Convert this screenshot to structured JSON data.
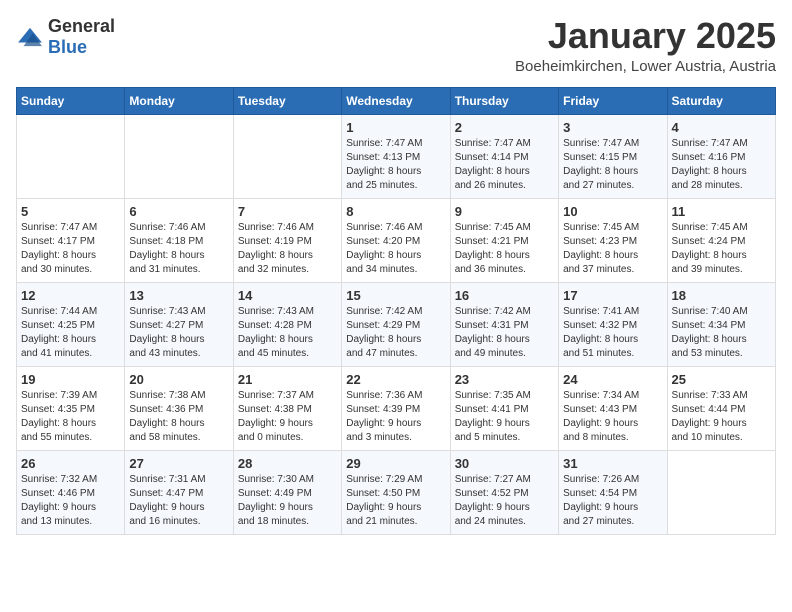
{
  "header": {
    "logo_general": "General",
    "logo_blue": "Blue",
    "month_title": "January 2025",
    "location": "Boeheimkirchen, Lower Austria, Austria"
  },
  "days_of_week": [
    "Sunday",
    "Monday",
    "Tuesday",
    "Wednesday",
    "Thursday",
    "Friday",
    "Saturday"
  ],
  "weeks": [
    {
      "cells": [
        {
          "day": null,
          "content": null
        },
        {
          "day": null,
          "content": null
        },
        {
          "day": null,
          "content": null
        },
        {
          "day": "1",
          "content": "Sunrise: 7:47 AM\nSunset: 4:13 PM\nDaylight: 8 hours\nand 25 minutes."
        },
        {
          "day": "2",
          "content": "Sunrise: 7:47 AM\nSunset: 4:14 PM\nDaylight: 8 hours\nand 26 minutes."
        },
        {
          "day": "3",
          "content": "Sunrise: 7:47 AM\nSunset: 4:15 PM\nDaylight: 8 hours\nand 27 minutes."
        },
        {
          "day": "4",
          "content": "Sunrise: 7:47 AM\nSunset: 4:16 PM\nDaylight: 8 hours\nand 28 minutes."
        }
      ]
    },
    {
      "cells": [
        {
          "day": "5",
          "content": "Sunrise: 7:47 AM\nSunset: 4:17 PM\nDaylight: 8 hours\nand 30 minutes."
        },
        {
          "day": "6",
          "content": "Sunrise: 7:46 AM\nSunset: 4:18 PM\nDaylight: 8 hours\nand 31 minutes."
        },
        {
          "day": "7",
          "content": "Sunrise: 7:46 AM\nSunset: 4:19 PM\nDaylight: 8 hours\nand 32 minutes."
        },
        {
          "day": "8",
          "content": "Sunrise: 7:46 AM\nSunset: 4:20 PM\nDaylight: 8 hours\nand 34 minutes."
        },
        {
          "day": "9",
          "content": "Sunrise: 7:45 AM\nSunset: 4:21 PM\nDaylight: 8 hours\nand 36 minutes."
        },
        {
          "day": "10",
          "content": "Sunrise: 7:45 AM\nSunset: 4:23 PM\nDaylight: 8 hours\nand 37 minutes."
        },
        {
          "day": "11",
          "content": "Sunrise: 7:45 AM\nSunset: 4:24 PM\nDaylight: 8 hours\nand 39 minutes."
        }
      ]
    },
    {
      "cells": [
        {
          "day": "12",
          "content": "Sunrise: 7:44 AM\nSunset: 4:25 PM\nDaylight: 8 hours\nand 41 minutes."
        },
        {
          "day": "13",
          "content": "Sunrise: 7:43 AM\nSunset: 4:27 PM\nDaylight: 8 hours\nand 43 minutes."
        },
        {
          "day": "14",
          "content": "Sunrise: 7:43 AM\nSunset: 4:28 PM\nDaylight: 8 hours\nand 45 minutes."
        },
        {
          "day": "15",
          "content": "Sunrise: 7:42 AM\nSunset: 4:29 PM\nDaylight: 8 hours\nand 47 minutes."
        },
        {
          "day": "16",
          "content": "Sunrise: 7:42 AM\nSunset: 4:31 PM\nDaylight: 8 hours\nand 49 minutes."
        },
        {
          "day": "17",
          "content": "Sunrise: 7:41 AM\nSunset: 4:32 PM\nDaylight: 8 hours\nand 51 minutes."
        },
        {
          "day": "18",
          "content": "Sunrise: 7:40 AM\nSunset: 4:34 PM\nDaylight: 8 hours\nand 53 minutes."
        }
      ]
    },
    {
      "cells": [
        {
          "day": "19",
          "content": "Sunrise: 7:39 AM\nSunset: 4:35 PM\nDaylight: 8 hours\nand 55 minutes."
        },
        {
          "day": "20",
          "content": "Sunrise: 7:38 AM\nSunset: 4:36 PM\nDaylight: 8 hours\nand 58 minutes."
        },
        {
          "day": "21",
          "content": "Sunrise: 7:37 AM\nSunset: 4:38 PM\nDaylight: 9 hours\nand 0 minutes."
        },
        {
          "day": "22",
          "content": "Sunrise: 7:36 AM\nSunset: 4:39 PM\nDaylight: 9 hours\nand 3 minutes."
        },
        {
          "day": "23",
          "content": "Sunrise: 7:35 AM\nSunset: 4:41 PM\nDaylight: 9 hours\nand 5 minutes."
        },
        {
          "day": "24",
          "content": "Sunrise: 7:34 AM\nSunset: 4:43 PM\nDaylight: 9 hours\nand 8 minutes."
        },
        {
          "day": "25",
          "content": "Sunrise: 7:33 AM\nSunset: 4:44 PM\nDaylight: 9 hours\nand 10 minutes."
        }
      ]
    },
    {
      "cells": [
        {
          "day": "26",
          "content": "Sunrise: 7:32 AM\nSunset: 4:46 PM\nDaylight: 9 hours\nand 13 minutes."
        },
        {
          "day": "27",
          "content": "Sunrise: 7:31 AM\nSunset: 4:47 PM\nDaylight: 9 hours\nand 16 minutes."
        },
        {
          "day": "28",
          "content": "Sunrise: 7:30 AM\nSunset: 4:49 PM\nDaylight: 9 hours\nand 18 minutes."
        },
        {
          "day": "29",
          "content": "Sunrise: 7:29 AM\nSunset: 4:50 PM\nDaylight: 9 hours\nand 21 minutes."
        },
        {
          "day": "30",
          "content": "Sunrise: 7:27 AM\nSunset: 4:52 PM\nDaylight: 9 hours\nand 24 minutes."
        },
        {
          "day": "31",
          "content": "Sunrise: 7:26 AM\nSunset: 4:54 PM\nDaylight: 9 hours\nand 27 minutes."
        },
        {
          "day": null,
          "content": null
        }
      ]
    }
  ]
}
